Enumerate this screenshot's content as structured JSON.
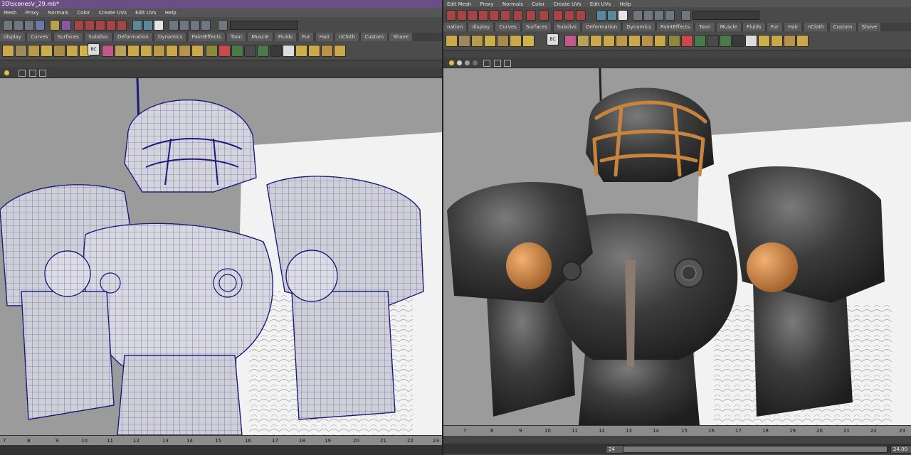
{
  "left": {
    "title": "3D\\scenes\\r_29.mb*",
    "menus": [
      "Mesh",
      "Proxy",
      "Normals",
      "Color",
      "Create UVs",
      "Edit UVs",
      "Help"
    ],
    "shelf_tabs": [
      "display",
      "Curves",
      "Surfaces",
      "Subdivs",
      "Deformation",
      "Dynamics",
      "PaintEffects",
      "Toon",
      "Muscle",
      "Fluids",
      "Fur",
      "Hair",
      "nCloth",
      "Custom",
      "Shave"
    ],
    "shelf_icon_text": "BC",
    "time_ticks": [
      "7",
      "8",
      "9",
      "10",
      "11",
      "12",
      "13",
      "14",
      "15",
      "16",
      "17",
      "18",
      "19",
      "20",
      "21",
      "22",
      "23"
    ]
  },
  "right": {
    "menus": [
      "Edit Mesh",
      "Proxy",
      "Normals",
      "Color",
      "Create UVs",
      "Edit UVs",
      "Help"
    ],
    "shelf_tabs": [
      "nation",
      "display",
      "Curves",
      "Surfaces",
      "Subdivs",
      "Deformation",
      "Dynamics",
      "PaintEffects",
      "Toon",
      "Muscle",
      "Fluids",
      "Fur",
      "Hair",
      "nCloth",
      "Custom",
      "Shave"
    ],
    "shelf_icon_text": "BC",
    "time_ticks": [
      "7",
      "8",
      "9",
      "10",
      "11",
      "12",
      "13",
      "14",
      "15",
      "16",
      "17",
      "18",
      "19",
      "20",
      "21",
      "22",
      "23"
    ],
    "range_start": "24",
    "range_end": "24.00"
  },
  "colors": {
    "titlebar": "#6a4f85",
    "viewport_bg": "#9b9b9b",
    "wire": "#2a2aa8",
    "armor_dark": "#3b3b3b",
    "orange": "#c8843f"
  }
}
